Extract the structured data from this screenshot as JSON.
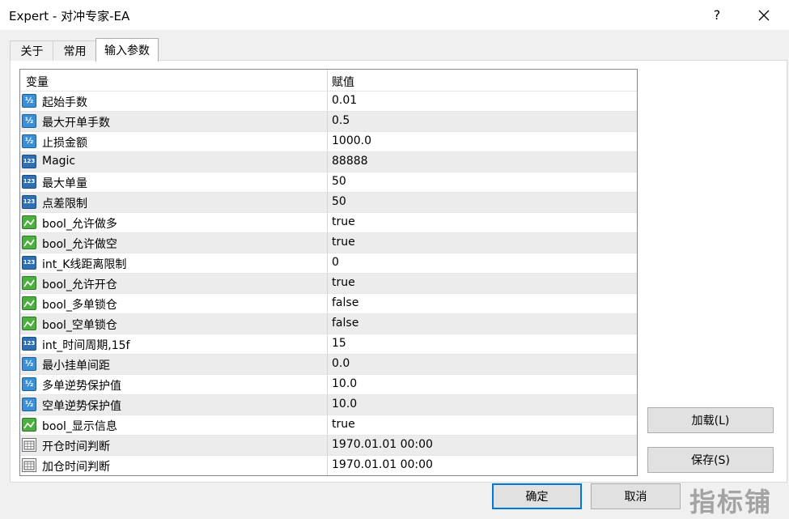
{
  "window": {
    "title": "Expert - 对冲专家-EA",
    "help_label": "?"
  },
  "tabs": [
    {
      "label": "关于"
    },
    {
      "label": "常用"
    },
    {
      "label": "输入参数"
    }
  ],
  "grid": {
    "col_variable": "变量",
    "col_value": "赋值",
    "rows": [
      {
        "type": "double",
        "name": "起始手数",
        "value": "0.01"
      },
      {
        "type": "double",
        "name": "最大开单手数",
        "value": "0.5"
      },
      {
        "type": "double",
        "name": "止损金额",
        "value": "1000.0"
      },
      {
        "type": "int",
        "name": "Magic",
        "value": "88888"
      },
      {
        "type": "int",
        "name": "最大单量",
        "value": "50"
      },
      {
        "type": "int",
        "name": "点差限制",
        "value": "50"
      },
      {
        "type": "bool",
        "name": "bool_允许做多",
        "value": "true"
      },
      {
        "type": "bool",
        "name": "bool_允许做空",
        "value": "true"
      },
      {
        "type": "int",
        "name": "int_K线距离限制",
        "value": "0"
      },
      {
        "type": "bool",
        "name": "bool_允许开仓",
        "value": "true"
      },
      {
        "type": "bool",
        "name": "bool_多单锁仓",
        "value": "false"
      },
      {
        "type": "bool",
        "name": "bool_空单锁仓",
        "value": "false"
      },
      {
        "type": "int",
        "name": "int_时间周期,15f",
        "value": "15"
      },
      {
        "type": "double",
        "name": "最小挂单间距",
        "value": "0.0"
      },
      {
        "type": "double",
        "name": "多单逆势保护值",
        "value": "10.0"
      },
      {
        "type": "double",
        "name": "空单逆势保护值",
        "value": "10.0"
      },
      {
        "type": "bool",
        "name": "bool_显示信息",
        "value": "true"
      },
      {
        "type": "datetime",
        "name": "开仓时间判断",
        "value": "1970.01.01 00:00"
      },
      {
        "type": "datetime",
        "name": "加仓时间判断",
        "value": "1970.01.01 00:00"
      }
    ]
  },
  "buttons": {
    "load": "加载(L)",
    "save": "保存(S)",
    "ok": "确定",
    "cancel": "取消"
  },
  "icons": {
    "double": "½",
    "int": "123"
  },
  "watermark": "指标铺"
}
